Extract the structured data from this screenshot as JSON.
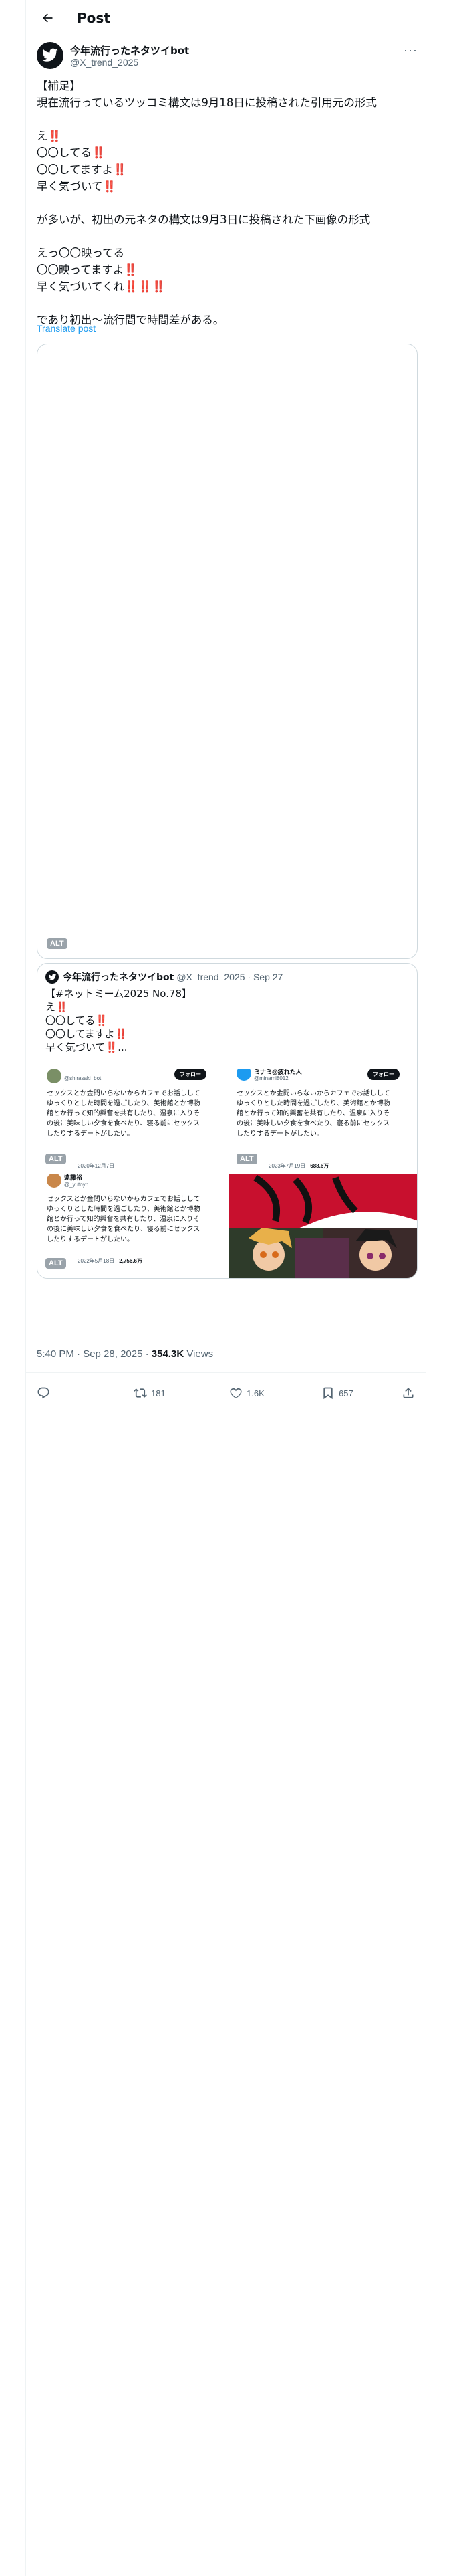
{
  "header": {
    "title": "Post"
  },
  "author": {
    "name": "今年流行ったネタツイbot",
    "handle": "@X_trend_2025"
  },
  "post": {
    "text": "【補足】\n現在流行っているツッコミ構文は9月18日に投稿された引用元の形式\n\nえ‼️\n〇〇してる‼️\n〇〇してますよ‼️\n早く気づいて‼️\n\nが多いが、初出の元ネタの構文は9月3日に投稿された下画像の形式\n\nえっ〇〇映ってる\n〇〇映ってますよ‼️\n早く気づいてくれ‼️‼️‼️\n\nであり初出〜流行間で時間差がある。",
    "translate_label": "Translate post",
    "media_alt": "ALT"
  },
  "quote": {
    "name": "今年流行ったネタツイbot",
    "handle_date": "@X_trend_2025 · Sep 27",
    "text": "【#ネットミーム2025 No.78】\nえ‼️\n〇〇してる‼️\n〇〇してますよ‼️\n早く気づいて‼️...",
    "alt": "ALT",
    "shots": [
      {
        "name": "",
        "handle": "@shirasaki_bot",
        "follow": "フォロー",
        "body": "セックスとか金問いらないからカフェでお話しして\nゆっくりとした時間を過ごしたり、美術館とか博物\n館とか行って知的興奮を共有したり、温泉に入りそ\nの後に美味しい夕食を食べたり、寝る前にセックス\nしたりするデートがしたい。",
        "meta": "2020年12月7日",
        "views": ""
      },
      {
        "name": "ミナミ@疲れた人",
        "handle": "@minami8012",
        "follow": "フォロー",
        "body": "セックスとか金問いらないからカフェでお話しして\nゆっくりとした時間を過ごしたり、美術館とか博物\n館とか行って知的興奮を共有したり、温泉に入りそ\nの後に美味しい夕食を食べたり、寝る前にセックス\nしたりするデートがしたい。",
        "meta": "2023年7月19日",
        "views": "688.6万"
      },
      {
        "name": "遠藤裕",
        "handle": "@_yutoyh",
        "follow": "",
        "body": "セックスとか金問いらないからカフェでお話しして\nゆっくりとした時間を過ごしたり、美術館とか博物\n館とか行って知的興奮を共有したり、温泉に入りそ\nの後に美味しい夕食を食べたり、寝る前にセックス\nしたりするデートがしたい。",
        "meta": "2022年5月18日",
        "views": "2,756.6万"
      }
    ]
  },
  "meta": {
    "time_date": "5:40 PM · Sep 28, 2025 · ",
    "views": "354.3K",
    "views_label": " Views"
  },
  "actions": {
    "retweets": "181",
    "likes": "1.6K",
    "bookmarks": "657"
  },
  "colors": {
    "accent": "#1d9bf0",
    "alt_badge": "#9aa3aa",
    "border": "#cfd9de"
  }
}
